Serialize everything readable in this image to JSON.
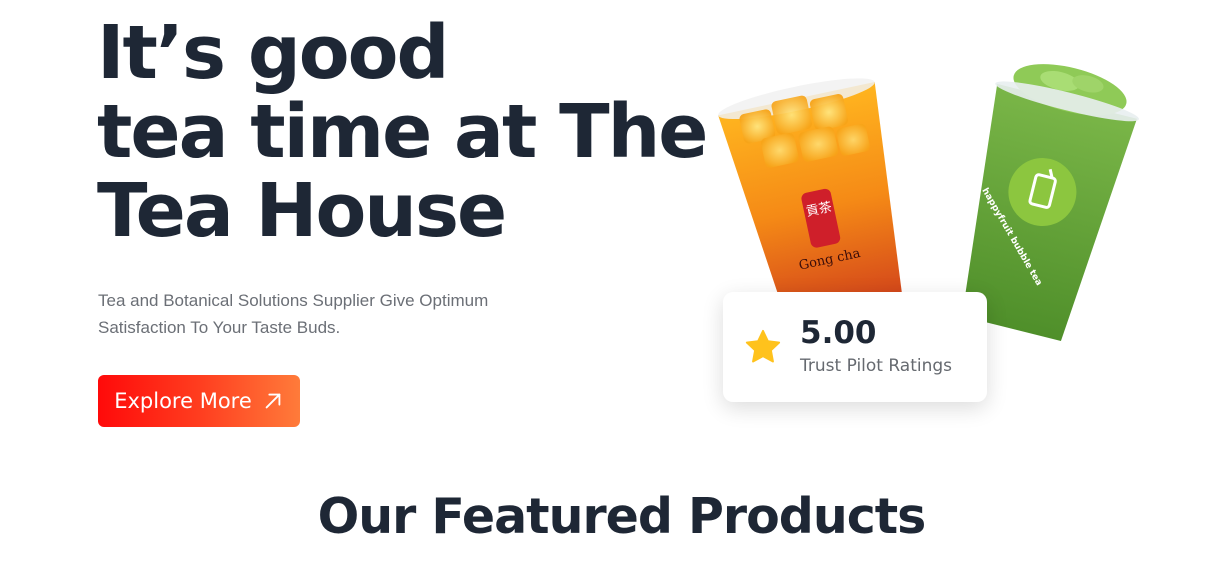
{
  "hero": {
    "title_lines": [
      "It’s good",
      "tea time at The",
      "Tea House"
    ],
    "subtitle": "Tea and Botanical Solutions Supplier Give Optimum Satisfaction To Your Taste Buds.",
    "cta_label": "Explore More",
    "cta_icon": "arrow-up-right-icon"
  },
  "products_image": {
    "cup1_logo_text": "Gong cha",
    "cup1_logo_glyph": "貢茶",
    "cup2_logo_text": "happyfruit bubble tea"
  },
  "rating_card": {
    "value": "5.00",
    "label": "Trust Pilot Ratings",
    "icon": "star-icon"
  },
  "featured": {
    "heading": "Our Featured Products"
  },
  "colors": {
    "text_dark": "#1e2735",
    "text_muted": "#6b6f76",
    "cta_gradient_start": "#ff0a0a",
    "cta_gradient_end": "#ff7b3a",
    "star": "#ffc21c"
  }
}
